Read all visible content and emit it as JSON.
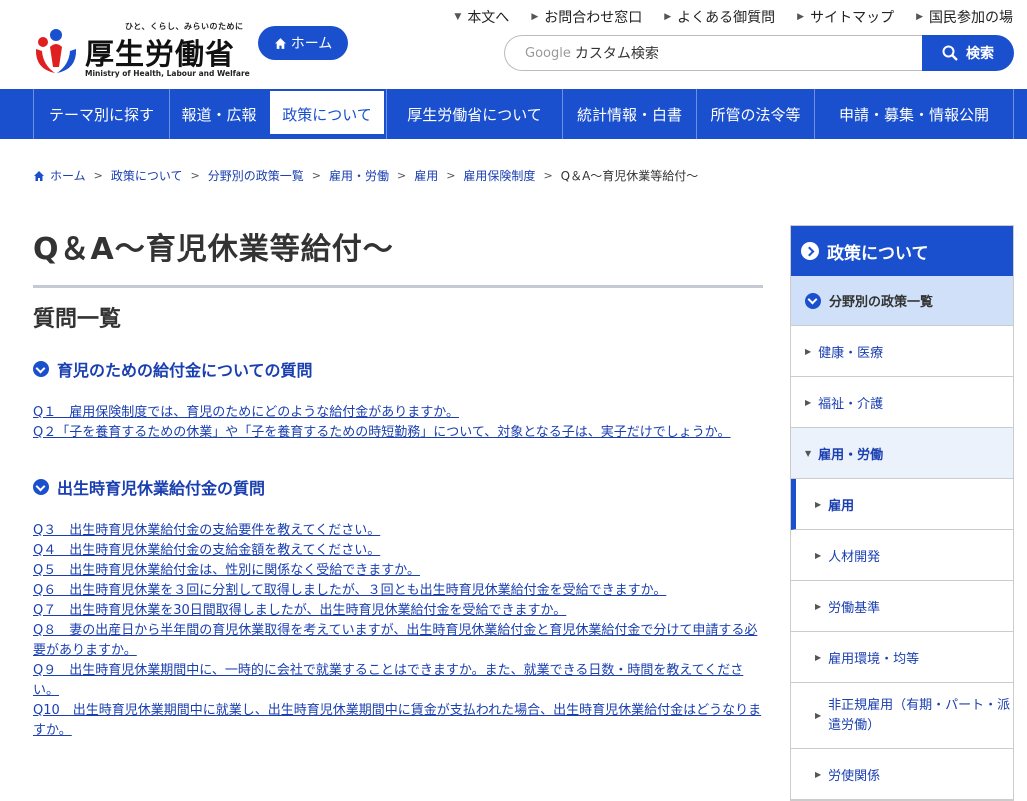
{
  "header": {
    "logo_tagline": "ひと、くらし、みらいのために",
    "logo_name": "厚生労働省",
    "logo_en": "Ministry of Health, Labour and Welfare",
    "home_label": "ホーム",
    "util_links": [
      "本文へ",
      "お問合わせ窓口",
      "よくある御質問",
      "サイトマップ",
      "国民参加の場"
    ],
    "search_brand": "Google",
    "search_placeholder": "カスタム検索",
    "search_button": "検索"
  },
  "gnav": [
    "テーマ別に探す",
    "報道・広報",
    "政策について",
    "厚生労働省について",
    "統計情報・白書",
    "所管の法令等",
    "申請・募集・情報公開"
  ],
  "breadcrumb": [
    "ホーム",
    "政策について",
    "分野別の政策一覧",
    "雇用・労働",
    "雇用",
    "雇用保険制度",
    "Q＆A～育児休業等給付～"
  ],
  "main": {
    "title": "Q＆A～育児休業等給付～",
    "section_title": "質問一覧",
    "group1_title": "育児のための給付金についての質問",
    "group1_items": [
      "Q１　雇用保険制度では、育児のためにどのような給付金がありますか。",
      "Q２「子を養育するための休業」や「子を養育するための時短勤務」について、対象となる子は、実子だけでしょうか。"
    ],
    "group2_title": "出生時育児休業給付金の質問",
    "group2_items": [
      "Q３　出生時育児休業給付金の支給要件を教えてください。",
      "Q４　出生時育児休業給付金の支給金額を教えてください。",
      "Q５　出生時育児休業給付金は、性別に関係なく受給できますか。",
      "Q６　出生時育児休業を３回に分割して取得しましたが、３回とも出生時育児休業給付金を受給できますか。",
      "Q７　出生時育児休業を30日間取得しましたが、出生時育児休業給付金を受給できますか。",
      "Q８　妻の出産日から半年間の育児休業取得を考えていますが、出生時育児休業給付金と育児休業給付金で分けて申請する必要がありますか。",
      "Q９　出生時育児休業期間中に、一時的に会社で就業することはできますか。また、就業できる日数・時間を教えてください。",
      "Q10　出生時育児休業期間中に就業し、出生時育児休業期間中に賃金が支払われた場合、出生時育児休業給付金はどうなりますか。"
    ]
  },
  "sidebar": {
    "head": "政策について",
    "sub": "分野別の政策一覧",
    "items": [
      "健康・医療",
      "福祉・介護",
      "雇用・労働"
    ],
    "children": [
      "雇用",
      "人材開発",
      "労働基準",
      "雇用環境・均等",
      "非正規雇用（有期・パート・派遣労働）",
      "労使関係"
    ]
  }
}
